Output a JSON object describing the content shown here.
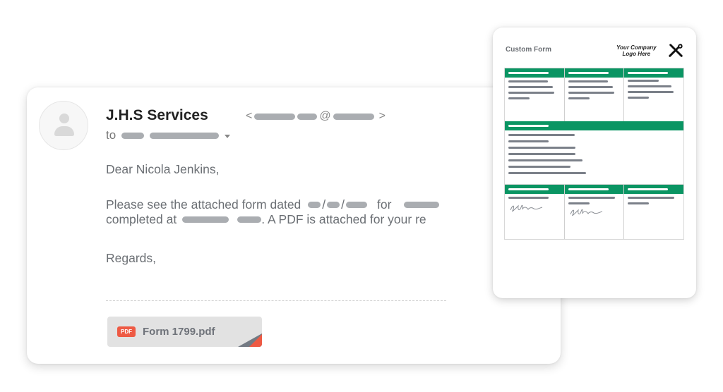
{
  "email": {
    "sender_name": "J.H.S Services",
    "sender_email": {
      "open": "<",
      "at": "@",
      "close": ">",
      "redacted": true
    },
    "to_label": "to",
    "greeting": "Dear Nicola Jenkins,",
    "para_line1_a": "Please see the attached form dated",
    "para_sep": "/",
    "para_line1_b": "for",
    "para_line2_a": "completed at",
    "para_line2_b": ". A PDF is attached for your re",
    "regards": "Regards,",
    "attachment": {
      "badge": "PDF",
      "filename": "Form 1799.pdf"
    }
  },
  "form_preview": {
    "title": "Custom Form",
    "logo_line1": "Your Company",
    "logo_line2": "Logo Here",
    "logo_icon": "tools-icon",
    "colors": {
      "header_green": "#0a9563",
      "line_grey": "#7b8089"
    }
  },
  "colors": {
    "accent_red": "#ee5a44",
    "text_grey": "#6b6f74"
  }
}
